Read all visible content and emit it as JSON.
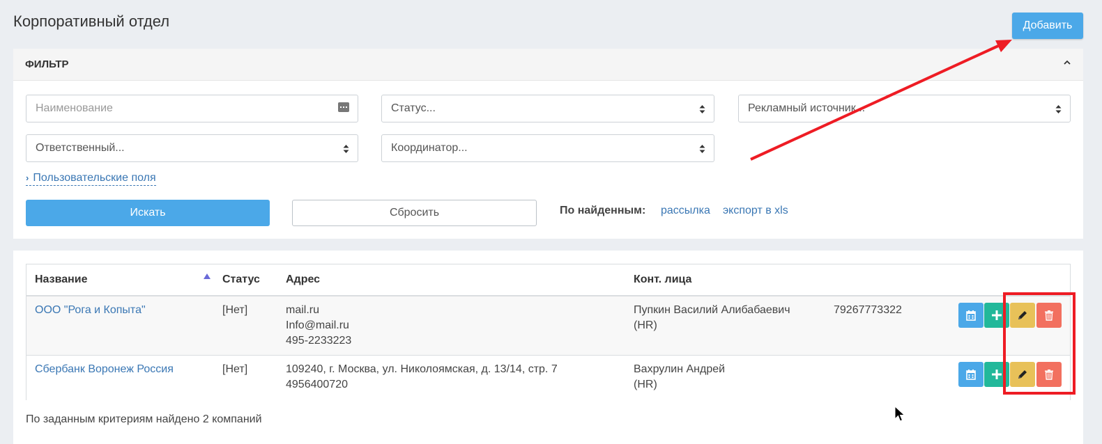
{
  "header": {
    "title": "Корпоративный отдел",
    "add_label": "Добавить"
  },
  "filter": {
    "title": "ФИЛЬТР",
    "name_placeholder": "Наименование",
    "status_label": "Статус...",
    "source_label": "Рекламный источник...",
    "responsible_label": "Ответственный...",
    "coordinator_label": "Координатор...",
    "custom_fields_label": "Пользовательские поля",
    "search_label": "Искать",
    "reset_label": "Сбросить",
    "found_label": "По найденным:",
    "mailing_label": "рассылка",
    "export_label": "экспорт в xls"
  },
  "table": {
    "columns": [
      "Название",
      "Статус",
      "Адрес",
      "Конт. лица"
    ],
    "rows": [
      {
        "name": "ООО \"Рога и Копыта\"",
        "status": "[Нет]",
        "address": [
          "mail.ru",
          "Info@mail.ru",
          "495-2233223"
        ],
        "contact": [
          "Пупкин Василий Алибабаевич",
          "(HR)"
        ],
        "phone": "79267773322"
      },
      {
        "name": "Сбербанк Воронеж Россия",
        "status": "[Нет]",
        "address": [
          "109240, г. Москва, ул. Николоямская, д. 13/14, стр. 7",
          "4956400720"
        ],
        "contact": [
          "Вахрулин Андрей",
          "(HR)"
        ],
        "phone": ""
      }
    ]
  },
  "footer": {
    "summary": "По заданным критериям найдено 2 компаний"
  },
  "colors": {
    "primary": "#4ba8e8",
    "success": "#22b89a",
    "warning": "#e8c159",
    "danger": "#f2705f",
    "annotation": "#ee1c24"
  },
  "icons": {
    "row_actions": [
      "calendar-icon",
      "plus-icon",
      "pencil-icon",
      "trash-icon"
    ]
  }
}
